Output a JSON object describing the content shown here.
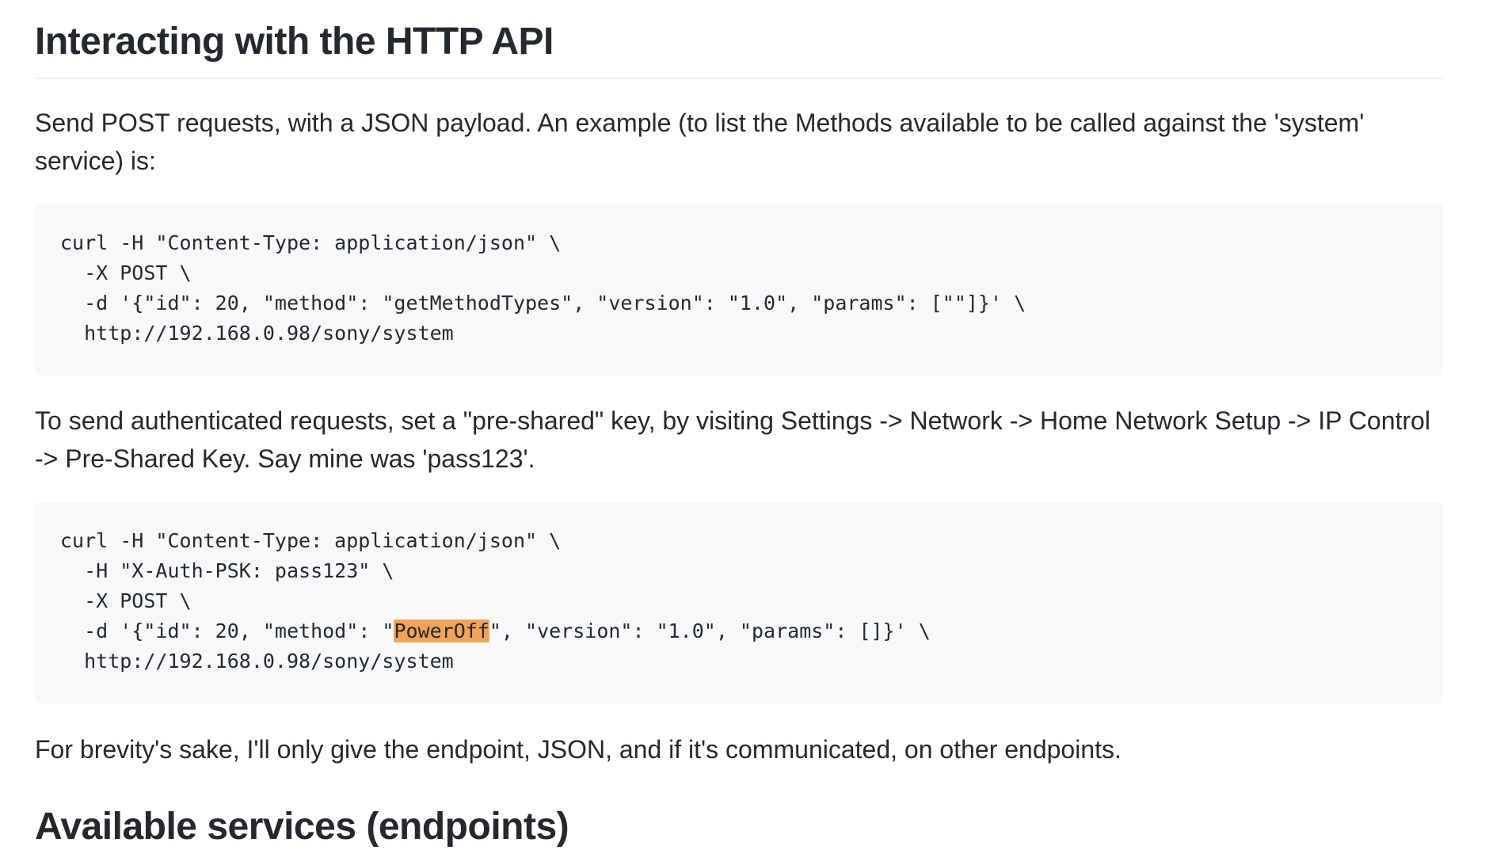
{
  "heading_http_api": "Interacting with the HTTP API",
  "intro_paragraph": "Send POST requests, with a JSON payload. An example (to list the Methods available to be called against the 'system' service) is:",
  "code_example_1": {
    "lines": [
      "curl -H \"Content-Type: application/json\" \\",
      "  -X POST \\",
      "  -d '{\"id\": 20, \"method\": \"getMethodTypes\", \"version\": \"1.0\", \"params\": [\"\"]}' \\",
      "  http://192.168.0.98/sony/system"
    ]
  },
  "auth_paragraph": "To send authenticated requests, set a \"pre-shared\" key, by visiting Settings -> Network -> Home Network Setup -> IP Control -> Pre-Shared Key. Say mine was 'pass123'.",
  "code_example_2": {
    "line1": "curl -H \"Content-Type: application/json\" \\",
    "line2": "  -H \"X-Auth-PSK: pass123\" \\",
    "line3": "  -X POST \\",
    "line4_before": "  -d '{\"id\": 20, \"method\": \"",
    "line4_highlight": "PowerOff",
    "line4_after": "\", \"version\": \"1.0\", \"params\": []}' \\",
    "line5": "  http://192.168.0.98/sony/system",
    "highlight_color": "#f2a35a"
  },
  "brevity_paragraph": "For brevity's sake, I'll only give the endpoint, JSON, and if it's communicated, on other endpoints.",
  "heading_services": "Available services (endpoints)"
}
